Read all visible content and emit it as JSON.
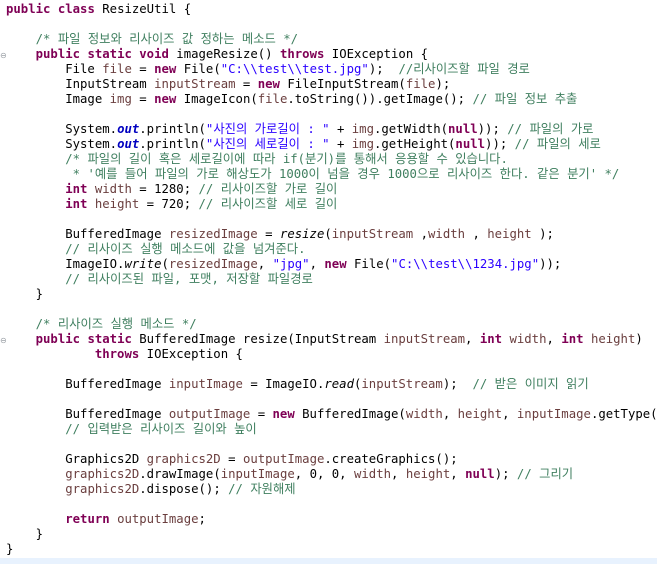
{
  "lines": [
    {
      "segments": [
        [
          "kw",
          "public"
        ],
        [
          "",
          " "
        ],
        [
          "kw",
          "class"
        ],
        [
          "",
          " ResizeUtil {"
        ]
      ]
    },
    {
      "segments": []
    },
    {
      "segments": [
        [
          "",
          "    "
        ],
        [
          "cm",
          "/* 파일 정보와 리사이즈 값 정하는 메소드 */"
        ]
      ]
    },
    {
      "segments": [
        [
          "",
          "    "
        ],
        [
          "kw",
          "public"
        ],
        [
          "",
          " "
        ],
        [
          "kw",
          "static"
        ],
        [
          "",
          " "
        ],
        [
          "kw",
          "void"
        ],
        [
          "",
          " imageResize() "
        ],
        [
          "kw",
          "throws"
        ],
        [
          "",
          " IOException {"
        ]
      ]
    },
    {
      "segments": [
        [
          "",
          "        File "
        ],
        [
          "var",
          "file"
        ],
        [
          "",
          " = "
        ],
        [
          "kw",
          "new"
        ],
        [
          "",
          " File("
        ],
        [
          "str",
          "\"C:\\\\test\\\\test.jpg\""
        ],
        [
          "",
          ");  "
        ],
        [
          "cm",
          "//리사이즈할 파일 경로"
        ]
      ]
    },
    {
      "segments": [
        [
          "",
          "        InputStream "
        ],
        [
          "var",
          "inputStream"
        ],
        [
          "",
          " = "
        ],
        [
          "kw",
          "new"
        ],
        [
          "",
          " FileInputStream("
        ],
        [
          "var",
          "file"
        ],
        [
          "",
          ");"
        ]
      ]
    },
    {
      "segments": [
        [
          "",
          "        Image "
        ],
        [
          "var",
          "img"
        ],
        [
          "",
          " = "
        ],
        [
          "kw",
          "new"
        ],
        [
          "",
          " ImageIcon("
        ],
        [
          "var",
          "file"
        ],
        [
          "",
          ".toString()).getImage(); "
        ],
        [
          "cm",
          "// 파일 정보 추출"
        ]
      ]
    },
    {
      "segments": []
    },
    {
      "segments": [
        [
          "",
          "        System."
        ],
        [
          "fld",
          "out"
        ],
        [
          "",
          ".println("
        ],
        [
          "str",
          "\"사진의 가로길이 : \""
        ],
        [
          "",
          " + "
        ],
        [
          "var",
          "img"
        ],
        [
          "",
          ".getWidth("
        ],
        [
          "kw",
          "null"
        ],
        [
          "",
          ")); "
        ],
        [
          "cm",
          "// 파일의 가로"
        ]
      ]
    },
    {
      "segments": [
        [
          "",
          "        System."
        ],
        [
          "fld",
          "out"
        ],
        [
          "",
          ".println("
        ],
        [
          "str",
          "\"사진의 세로길이 : \""
        ],
        [
          "",
          " + "
        ],
        [
          "var",
          "img"
        ],
        [
          "",
          ".getHeight("
        ],
        [
          "kw",
          "null"
        ],
        [
          "",
          ")); "
        ],
        [
          "cm",
          "// 파일의 세로"
        ]
      ]
    },
    {
      "segments": [
        [
          "",
          "        "
        ],
        [
          "cm",
          "/* 파일의 길이 혹은 세로길이에 따라 if(분기)를 통해서 응용할 수 있습니다."
        ]
      ]
    },
    {
      "segments": [
        [
          "",
          "         "
        ],
        [
          "cm",
          "* '예를 들어 파일의 가로 해상도가 1000이 넘을 경우 1000으로 리사이즈 한다. 같은 분기' */"
        ]
      ]
    },
    {
      "segments": [
        [
          "",
          "        "
        ],
        [
          "kw",
          "int"
        ],
        [
          "",
          " "
        ],
        [
          "var",
          "width"
        ],
        [
          "",
          " = 1280; "
        ],
        [
          "cm",
          "// 리사이즈할 가로 길이"
        ]
      ]
    },
    {
      "segments": [
        [
          "",
          "        "
        ],
        [
          "kw",
          "int"
        ],
        [
          "",
          " "
        ],
        [
          "var",
          "height"
        ],
        [
          "",
          " = 720; "
        ],
        [
          "cm",
          "// 리사이즈할 세로 길이"
        ]
      ]
    },
    {
      "segments": []
    },
    {
      "segments": [
        [
          "",
          "        BufferedImage "
        ],
        [
          "var",
          "resizedImage"
        ],
        [
          "",
          " = "
        ],
        [
          "sm",
          "resize"
        ],
        [
          "",
          "("
        ],
        [
          "var",
          "inputStream"
        ],
        [
          "",
          " ,"
        ],
        [
          "var",
          "width"
        ],
        [
          "",
          " , "
        ],
        [
          "var",
          "height"
        ],
        [
          "",
          " );"
        ]
      ]
    },
    {
      "segments": [
        [
          "",
          "        "
        ],
        [
          "cm",
          "// 리사이즈 실행 메소드에 값을 넘겨준다."
        ]
      ]
    },
    {
      "segments": [
        [
          "",
          "        ImageIO."
        ],
        [
          "sm",
          "write"
        ],
        [
          "",
          "("
        ],
        [
          "var",
          "resizedImage"
        ],
        [
          "",
          ", "
        ],
        [
          "str",
          "\"jpg\""
        ],
        [
          "",
          ", "
        ],
        [
          "kw",
          "new"
        ],
        [
          "",
          " File("
        ],
        [
          "str",
          "\"C:\\\\test\\\\1234.jpg\""
        ],
        [
          "",
          "));"
        ]
      ]
    },
    {
      "segments": [
        [
          "",
          "        "
        ],
        [
          "cm",
          "// 리사이즈된 파일, 포맷, 저장할 파일경로"
        ]
      ]
    },
    {
      "segments": [
        [
          "",
          "    }"
        ]
      ]
    },
    {
      "segments": []
    },
    {
      "segments": [
        [
          "",
          "    "
        ],
        [
          "cm",
          "/* 리사이즈 실행 메소드 */"
        ]
      ]
    },
    {
      "segments": [
        [
          "",
          "    "
        ],
        [
          "kw",
          "public"
        ],
        [
          "",
          " "
        ],
        [
          "kw",
          "static"
        ],
        [
          "",
          " BufferedImage resize(InputStream "
        ],
        [
          "var",
          "inputStream"
        ],
        [
          "",
          ", "
        ],
        [
          "kw",
          "int"
        ],
        [
          "",
          " "
        ],
        [
          "var",
          "width"
        ],
        [
          "",
          ", "
        ],
        [
          "kw",
          "int"
        ],
        [
          "",
          " "
        ],
        [
          "var",
          "height"
        ],
        [
          "",
          ")"
        ]
      ]
    },
    {
      "segments": [
        [
          "",
          "            "
        ],
        [
          "kw",
          "throws"
        ],
        [
          "",
          " IOException {"
        ]
      ]
    },
    {
      "segments": []
    },
    {
      "segments": [
        [
          "",
          "        BufferedImage "
        ],
        [
          "var",
          "inputImage"
        ],
        [
          "",
          " = ImageIO."
        ],
        [
          "sm",
          "read"
        ],
        [
          "",
          "("
        ],
        [
          "var",
          "inputStream"
        ],
        [
          "",
          ");  "
        ],
        [
          "cm",
          "// 받은 이미지 읽기"
        ]
      ]
    },
    {
      "segments": []
    },
    {
      "segments": [
        [
          "",
          "        BufferedImage "
        ],
        [
          "var",
          "outputImage"
        ],
        [
          "",
          " = "
        ],
        [
          "kw",
          "new"
        ],
        [
          "",
          " BufferedImage("
        ],
        [
          "var",
          "width"
        ],
        [
          "",
          ", "
        ],
        [
          "var",
          "height"
        ],
        [
          "",
          ", "
        ],
        [
          "var",
          "inputImage"
        ],
        [
          "",
          ".getType());"
        ]
      ]
    },
    {
      "segments": [
        [
          "",
          "        "
        ],
        [
          "cm",
          "// 입력받은 리사이즈 길이와 높이"
        ]
      ]
    },
    {
      "segments": []
    },
    {
      "segments": [
        [
          "",
          "        Graphics2D "
        ],
        [
          "var",
          "graphics2D"
        ],
        [
          "",
          " = "
        ],
        [
          "var",
          "outputImage"
        ],
        [
          "",
          ".createGraphics();"
        ]
      ]
    },
    {
      "segments": [
        [
          "",
          "        "
        ],
        [
          "var",
          "graphics2D"
        ],
        [
          "",
          ".drawImage("
        ],
        [
          "var",
          "inputImage"
        ],
        [
          "",
          ", 0, 0, "
        ],
        [
          "var",
          "width"
        ],
        [
          "",
          ", "
        ],
        [
          "var",
          "height"
        ],
        [
          "",
          ", "
        ],
        [
          "kw",
          "null"
        ],
        [
          "",
          "); "
        ],
        [
          "cm",
          "// 그리기"
        ]
      ]
    },
    {
      "segments": [
        [
          "",
          "        "
        ],
        [
          "var",
          "graphics2D"
        ],
        [
          "",
          ".dispose(); "
        ],
        [
          "cm",
          "// 자원해제"
        ]
      ]
    },
    {
      "segments": []
    },
    {
      "segments": [
        [
          "",
          "        "
        ],
        [
          "kw",
          "return"
        ],
        [
          "",
          " "
        ],
        [
          "var",
          "outputImage"
        ],
        [
          "",
          ";"
        ]
      ]
    },
    {
      "segments": [
        [
          "",
          "    }"
        ]
      ]
    },
    {
      "segments": [
        [
          "",
          "}"
        ]
      ]
    }
  ],
  "fold_markers": {
    "method_1": "⊖",
    "method_2": "⊖"
  },
  "colors": {
    "keyword": "#7f0055",
    "string": "#2a00ff",
    "comment": "#3f7f5f",
    "static_field": "#0000c0",
    "local_variable": "#6a3e3e",
    "background": "#ffffff"
  }
}
